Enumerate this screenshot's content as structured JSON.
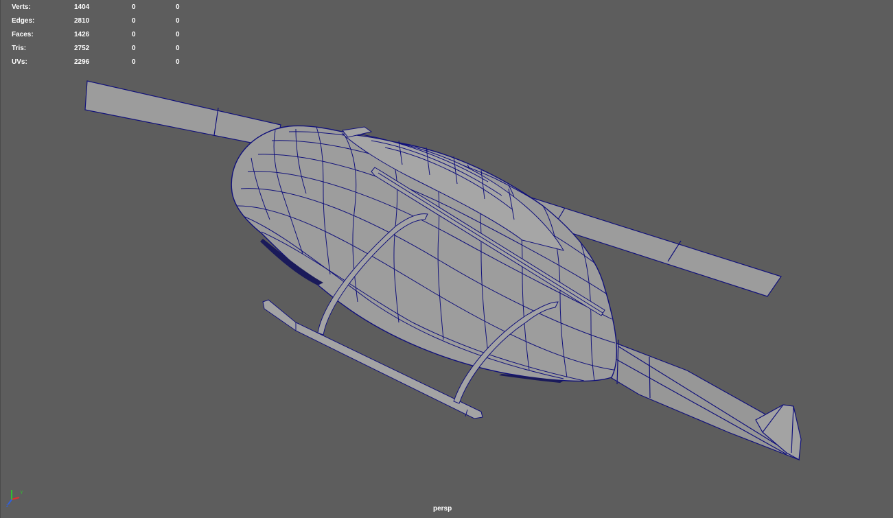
{
  "hud": {
    "rows": [
      {
        "label": "Verts:",
        "v1": "1404",
        "v2": "0",
        "v3": "0"
      },
      {
        "label": "Edges:",
        "v1": "2810",
        "v2": "0",
        "v3": "0"
      },
      {
        "label": "Faces:",
        "v1": "1426",
        "v2": "0",
        "v3": "0"
      },
      {
        "label": "Tris:",
        "v1": "2752",
        "v2": "0",
        "v3": "0"
      },
      {
        "label": "UVs:",
        "v1": "2296",
        "v2": "0",
        "v3": "0"
      }
    ]
  },
  "camera": {
    "label": "persp"
  },
  "colors": {
    "background": "#5d5d5d",
    "mesh_fill": "#9a9a9a",
    "wireframe": "#10107a",
    "hud_text": "#ffffff"
  }
}
